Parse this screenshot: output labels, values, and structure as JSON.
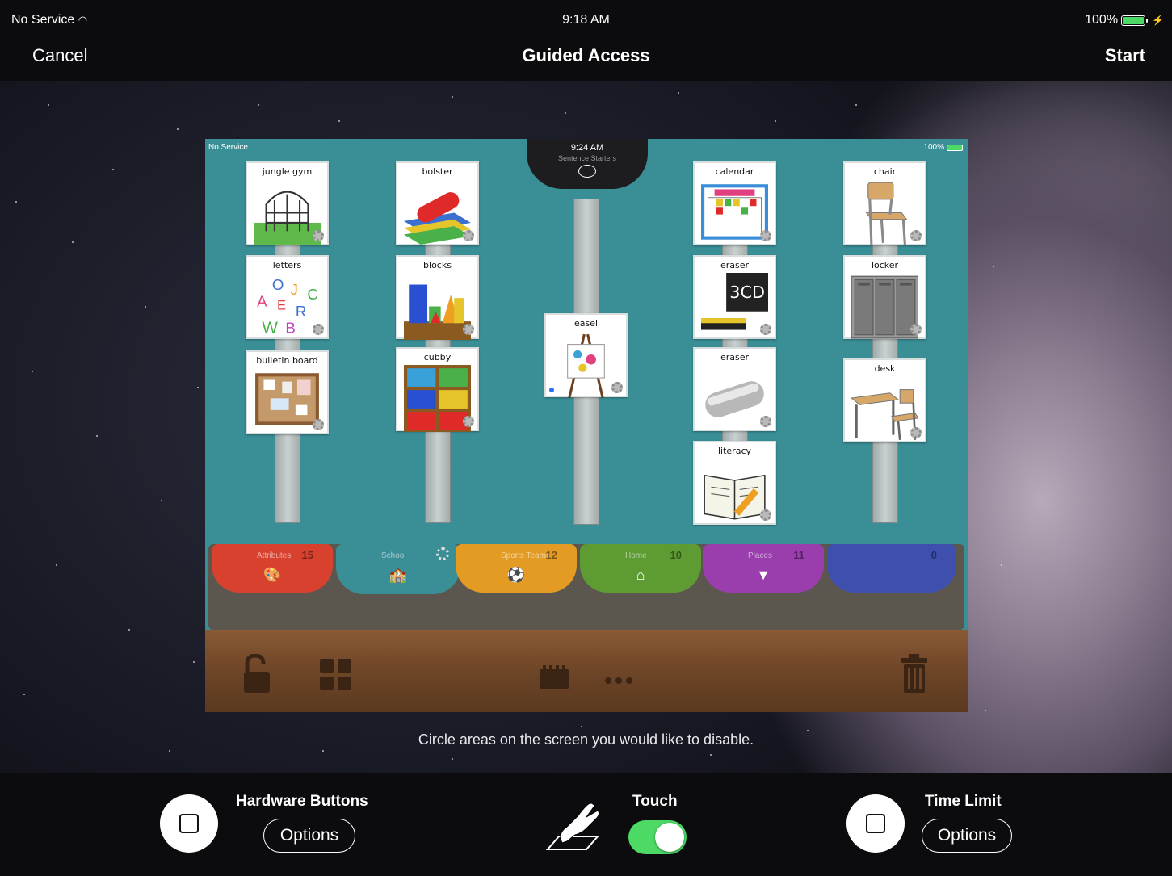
{
  "status_bar": {
    "carrier": "No Service",
    "time": "9:18 AM",
    "battery": "100%"
  },
  "nav": {
    "cancel": "Cancel",
    "title": "Guided Access",
    "start": "Start"
  },
  "app_screenshot": {
    "status": {
      "carrier": "No Service",
      "time": "9:24 AM",
      "battery": "100%"
    },
    "header_subtitle": "Sentence Starters",
    "cards": {
      "c1": "jungle gym",
      "c2": "letters",
      "c3": "bulletin board",
      "c4": "bolster",
      "c5": "blocks",
      "c6": "cubby",
      "c7": "easel",
      "c8": "calendar",
      "c9": "eraser",
      "c10": "eraser",
      "c11": "literacy",
      "c12": "chair",
      "c13": "locker",
      "c14": "desk"
    },
    "tabs": [
      {
        "label": "Attributes",
        "count": "15",
        "color": "#d9412f"
      },
      {
        "label": "School",
        "count": "",
        "color": "#3a8e96"
      },
      {
        "label": "Sports Teams",
        "count": "12",
        "color": "#e49b24"
      },
      {
        "label": "Home",
        "count": "10",
        "color": "#5e9c33"
      },
      {
        "label": "Places",
        "count": "11",
        "color": "#9a3eae"
      },
      {
        "label": "",
        "count": "0",
        "color": "#3f4fae"
      }
    ]
  },
  "instruction": "Circle areas on the screen you would like to disable.",
  "bottom": {
    "hardware_buttons": "Hardware Buttons",
    "hardware_options": "Options",
    "touch": "Touch",
    "time_limit": "Time Limit",
    "time_options": "Options"
  },
  "colors": {
    "switch_on": "#4cd964",
    "bar_bg": "#0c0c0e"
  }
}
